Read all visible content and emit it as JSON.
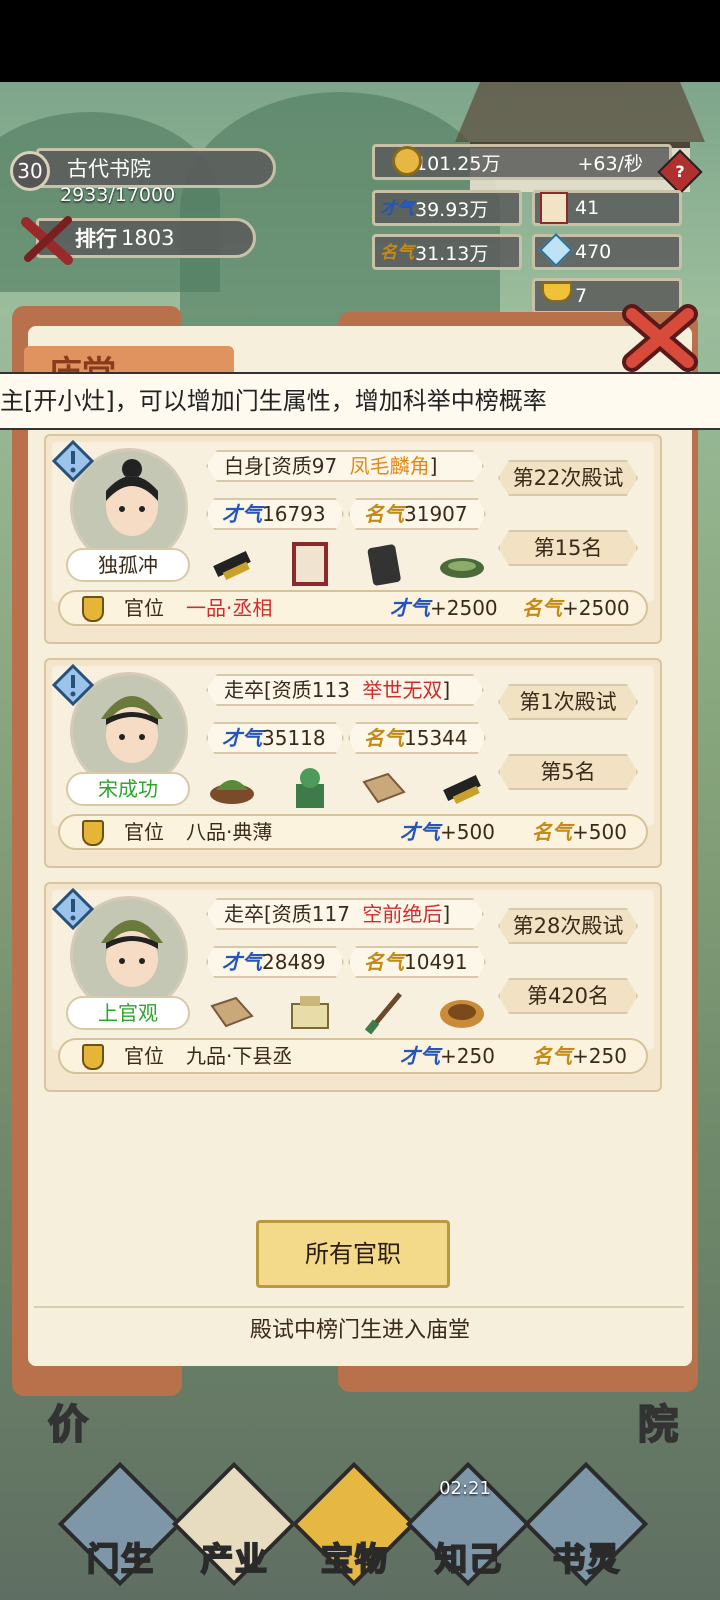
{
  "hud": {
    "level": "30",
    "academy_name": "古代书院",
    "exp": "2933/17000",
    "rank_label": "排行",
    "rank_value": "1803",
    "coins": "101.25万",
    "coin_rate": "+63/秒",
    "talent_icon": "才气",
    "talent": "39.93万",
    "fame_icon": "名气",
    "fame": "31.13万",
    "book_count": "41",
    "gem_count": "470",
    "ingot_count": "7",
    "help": "?"
  },
  "panel": {
    "title": "庙堂",
    "banner": "主[开小灶]，可以增加门生属性，增加科举中榜概率",
    "all_positions_button": "所有官职",
    "footer": "殿试中榜门生进入庙堂"
  },
  "labels": {
    "talent": "才气",
    "fame": "名气",
    "office": "官位"
  },
  "students": [
    {
      "name": "独孤冲",
      "name_color": "#3b2a1a",
      "status": "白身[资质97",
      "grade": "凤毛麟角",
      "grade_color": "#e08a1a",
      "close": "]",
      "talent": "16793",
      "fame": "31907",
      "exam": "第22次殿试",
      "place": "第15名",
      "office": "一品·丞相",
      "office_color": "#d02c2c",
      "talent_bonus": "+2500",
      "fame_bonus": "+2500",
      "items": [
        "ink-stick-icon",
        "scroll-frame-icon",
        "ink-stone-icon",
        "brush-rest-icon"
      ]
    },
    {
      "name": "宋成功",
      "name_color": "#2ea52e",
      "status": "走卒[资质113",
      "grade": "举世无双",
      "grade_color": "#d02c2c",
      "close": "]",
      "talent": "35118",
      "fame": "15344",
      "exam": "第1次殿试",
      "place": "第5名",
      "office": "八品·典薄",
      "office_color": "#3b2a1a",
      "talent_bonus": "+500",
      "fame_bonus": "+500",
      "items": [
        "herb-bowl-icon",
        "jade-seal-icon",
        "folded-paper-icon",
        "ink-stick-icon"
      ]
    },
    {
      "name": "上官观",
      "name_color": "#2ea52e",
      "status": "走卒[资质117",
      "grade": "空前绝后",
      "grade_color": "#d02c2c",
      "close": "]",
      "talent": "28489",
      "fame": "10491",
      "exam": "第28次殿试",
      "place": "第420名",
      "office": "九品·下县丞",
      "office_color": "#3b2a1a",
      "talent_bonus": "+250",
      "fame_bonus": "+250",
      "items": [
        "folded-paper-icon",
        "seal-box-icon",
        "brush-icon",
        "ink-plate-icon"
      ]
    }
  ],
  "nav": {
    "students": "门生",
    "industry": "产业",
    "treasure": "宝物",
    "confidant": "知己",
    "bookspirit": "书灵",
    "timer": "02:21",
    "left_char": "价",
    "right_char": "院"
  }
}
